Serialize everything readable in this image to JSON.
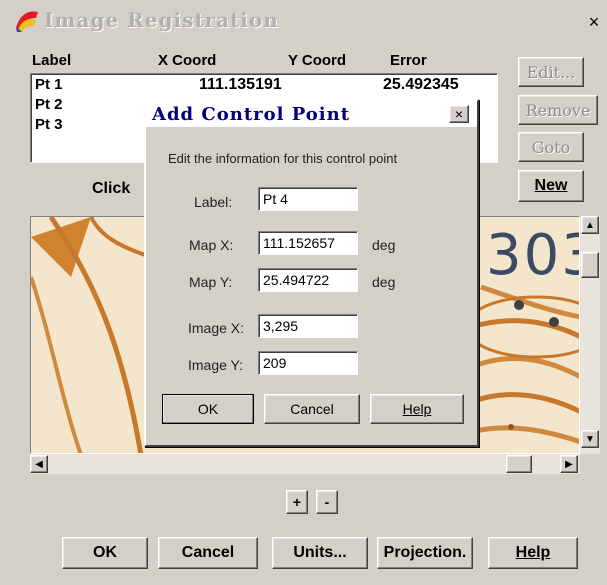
{
  "window": {
    "title": "Image Registration",
    "close_glyph": "×"
  },
  "table": {
    "headers": [
      "Label",
      "X Coord",
      "Y Coord",
      "Error"
    ],
    "rows": [
      {
        "label": "Pt 1",
        "x": "111.135191",
        "y": "",
        "error": "25.492345"
      },
      {
        "label": "Pt 2",
        "x": "",
        "y": "",
        "error": ""
      },
      {
        "label": "Pt 3",
        "x": "",
        "y": "",
        "error": ""
      }
    ]
  },
  "side_buttons": {
    "edit": "Edit...",
    "remove": "Remove",
    "goto": "Goto",
    "new": "New"
  },
  "instruction_text": "Click",
  "image_overlay_text": "303",
  "zoom": {
    "plus": "+",
    "minus": "-"
  },
  "bottom_buttons": {
    "ok": "OK",
    "cancel": "Cancel",
    "units": "Units...",
    "projection": "Projection.",
    "help": "Help"
  },
  "dialog": {
    "title": "Add Control Point",
    "close_glyph": "×",
    "instructions": "Edit the information for this control point",
    "label_label": "Label:",
    "label_value": "Pt 4",
    "mapx_label": "Map X:",
    "mapx_value": "111.152657",
    "mapx_unit": "deg",
    "mapy_label": "Map Y:",
    "mapy_value": "25.494722",
    "mapy_unit": "deg",
    "imagex_label": "Image X:",
    "imagex_value": "3,295",
    "imagey_label": "Image Y:",
    "imagey_value": "209",
    "ok": "OK",
    "cancel": "Cancel",
    "help": "Help"
  },
  "colors": {
    "face": "#d4d0c8",
    "dialog_title_text": "#00007a",
    "map_line": "#c8782a",
    "map_bg": "#f2e4c8"
  }
}
